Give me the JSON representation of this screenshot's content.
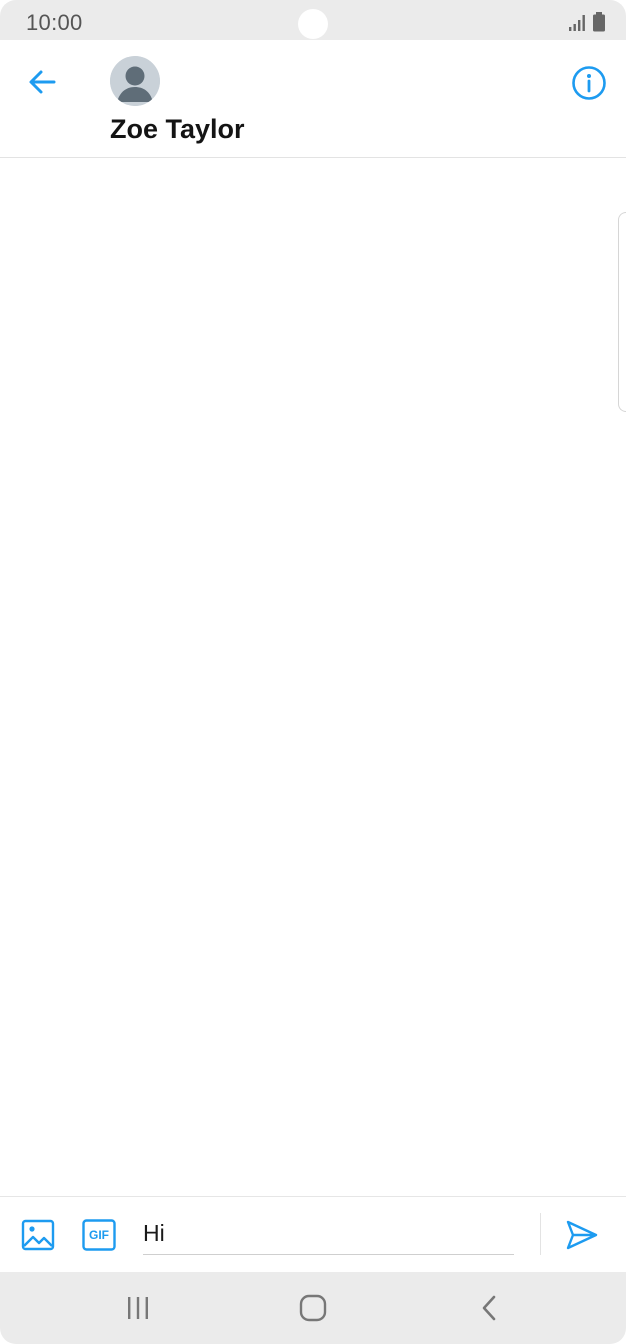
{
  "status_bar": {
    "time": "10:00",
    "icons": [
      "signal-icon",
      "battery-icon"
    ]
  },
  "header": {
    "back_icon": "arrow-left-icon",
    "avatar_icon": "default-avatar-icon",
    "contact_name": "Zoe Taylor",
    "info_icon": "info-circle-icon"
  },
  "composer": {
    "image_icon": "image-icon",
    "gif_label": "GIF",
    "message_value": "Hi",
    "send_icon": "send-icon"
  },
  "nav_bar": {
    "items": [
      "recents-icon",
      "home-icon",
      "back-icon"
    ]
  },
  "colors": {
    "accent": "#1d9bf0",
    "status_bar_bg": "#ebebeb",
    "text_primary": "#141414",
    "divider": "#e3e3e3"
  }
}
